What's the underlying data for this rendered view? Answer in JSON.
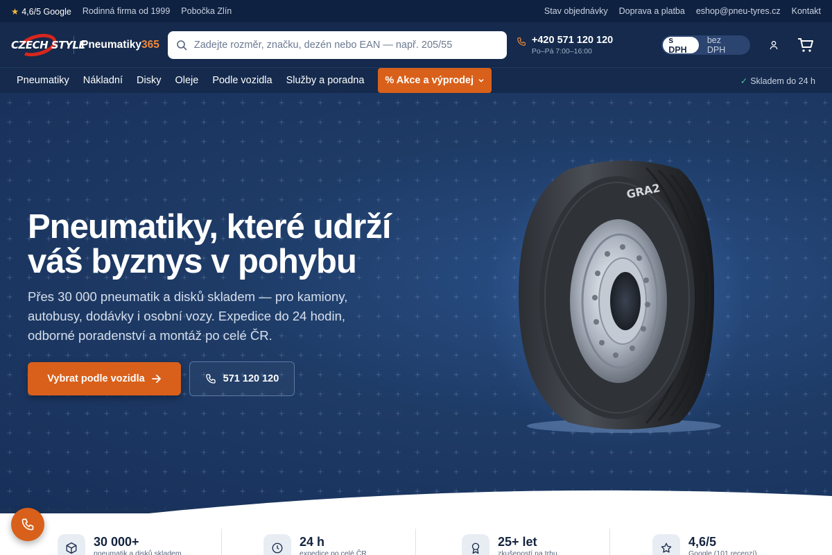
{
  "topbar": {
    "rating": "4,6/5 Google",
    "family": "Rodinná firma od 1999",
    "branch": "Pobočka Zlín",
    "links": [
      "Stav objednávky",
      "Doprava a platba",
      "eshop@pneu-tyres.cz",
      "Kontakt"
    ]
  },
  "header": {
    "logo_text": "CZECH STYLE",
    "brand_name": "Pneumatiky",
    "brand_num": "365",
    "search_placeholder": "Zadejte rozměr, značku, dezén nebo EAN — např. 205/55",
    "phone": "+420 571 120 120",
    "hours": "Po–Pá 7:00–16:00",
    "vat_on": "s DPH",
    "vat_off": "bez DPH"
  },
  "nav": {
    "items": [
      "Pneumatiky",
      "Nákladní",
      "Disky",
      "Oleje",
      "Podle vozidla",
      "Služby a poradna"
    ],
    "promo": "% Akce a výprodej",
    "stock": "Skladem do 24 h"
  },
  "hero": {
    "title_line1": "Pneumatiky, které udrží",
    "title_line2": "váš byznys v pohybu",
    "subtitle": "Přes 30 000 pneumatik a disků skladem — pro kamiony, autobusy, dodávky i osobní vozy. Expedice do 24 hodin, odborné poradenství a montáž po celé ČR.",
    "primary_cta": "Vybrat podle vozidla",
    "secondary_cta": "571 120 120",
    "tire_label": "GRA2"
  },
  "stats": [
    {
      "icon": "box-icon",
      "value": "30 000+",
      "label": "pneumatik a disků skladem"
    },
    {
      "icon": "clock-icon",
      "value": "24 h",
      "label": "expedice po celé ČR"
    },
    {
      "icon": "award-icon",
      "value": "25+ let",
      "label": "zkušeností na trhu"
    },
    {
      "icon": "star-icon",
      "value": "4,6/5",
      "label": "Google (101 recenzí)"
    }
  ],
  "colors": {
    "accent": "#d9601a",
    "navy": "#152a4c",
    "hero": "#1e3b66"
  }
}
